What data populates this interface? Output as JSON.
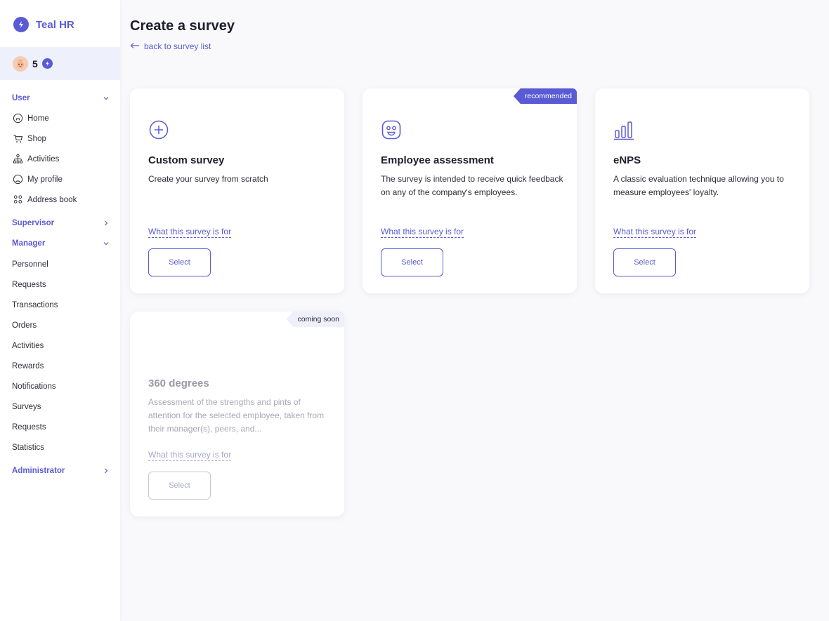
{
  "brand": {
    "name": "Teal HR",
    "color": "#5a5bd4"
  },
  "user": {
    "points": "5"
  },
  "sidebar": {
    "sections": [
      {
        "label": "User",
        "expanded": true
      },
      {
        "label": "Supervisor",
        "expanded": false
      },
      {
        "label": "Manager",
        "expanded": true
      },
      {
        "label": "Administrator",
        "expanded": false
      }
    ],
    "user_items": [
      {
        "label": "Home",
        "icon": "home-icon"
      },
      {
        "label": "Shop",
        "icon": "cart-icon"
      },
      {
        "label": "Activities",
        "icon": "activities-icon"
      },
      {
        "label": "My profile",
        "icon": "profile-icon"
      },
      {
        "label": "Address book",
        "icon": "address-book-icon"
      }
    ],
    "manager_items": [
      "Personnel",
      "Requests",
      "Transactions",
      "Orders",
      "Activities",
      "Rewards",
      "Notifications",
      "Surveys",
      "Requests",
      "Statistics"
    ]
  },
  "page": {
    "title": "Create a survey",
    "back_label": "back to survey list"
  },
  "cards": [
    {
      "title": "Custom survey",
      "description": "Create your survey from scratch",
      "link": "What this survey is for",
      "button": "Select",
      "icon": "plus-circle-icon",
      "tag": ""
    },
    {
      "title": "Employee assessment",
      "description": "The survey is intended to receive quick feedback on any of the company's employees.",
      "link": "What this survey is for",
      "button": "Select",
      "icon": "smiley-icon",
      "tag": "recommended"
    },
    {
      "title": "eNPS",
      "description": "A classic evaluation technique allowing you to measure employees' loyalty.",
      "link": "What this survey is for",
      "button": "Select",
      "icon": "bar-chart-icon",
      "tag": ""
    },
    {
      "title": "360 degrees",
      "description": "Assessment of the strengths and pints of attention for the selected employee, taken from their manager(s), peers, and...",
      "link": "What this survey is for",
      "button": "Select",
      "icon": "",
      "tag": "coming soon"
    }
  ]
}
